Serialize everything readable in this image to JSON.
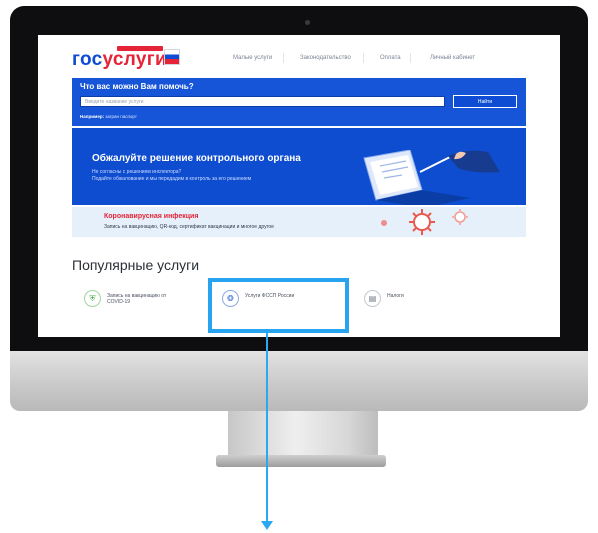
{
  "header": {
    "logo_part1": "гос",
    "logo_part2": "услуги",
    "nav_items": [
      "Малые услуги",
      "Законодательство",
      "Оплата",
      "Личный кабинет"
    ]
  },
  "search": {
    "title": "Что вас можно Вам помочь?",
    "placeholder": "Введите название услуги",
    "button_label": "Найти",
    "hint_label": "Например:",
    "hint_value": "загран паспорт"
  },
  "banner": {
    "title": "Обжалуйте решение контрольного органа",
    "subtitle_line1": "Не согласны с решением инспектора?",
    "subtitle_line2": "Подайте обжалование и мы передадим в контроль за его решением"
  },
  "covid": {
    "title": "Коронавирусная инфекция",
    "subtitle": "Запись на вакцинацию, QR-код, сертификат вакцинации и многое другое"
  },
  "popular": {
    "title": "Популярные услуги",
    "services": [
      {
        "label_line1": "Запись на вакцинацию от",
        "label_line2": "COVID-19",
        "icon": "shield-icon"
      },
      {
        "label_line1": "Услуги ФССП России",
        "label_line2": "",
        "icon": "emblem-icon"
      },
      {
        "label_line1": "Налоги",
        "label_line2": "",
        "icon": "tax-icon"
      }
    ]
  },
  "colors": {
    "brand_blue": "#0d4cd3",
    "brand_red": "#e52437",
    "highlight": "#27a3f0"
  }
}
